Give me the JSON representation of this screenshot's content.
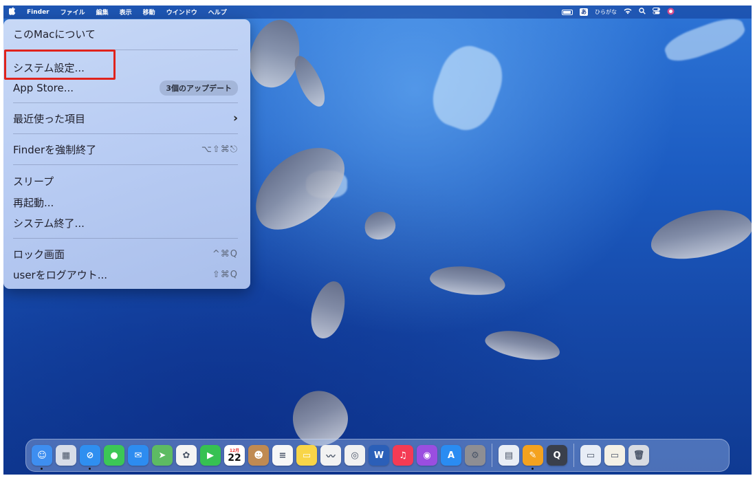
{
  "menubar": {
    "apple_icon": "",
    "items": [
      "Finder",
      "ファイル",
      "編集",
      "表示",
      "移動",
      "ウインドウ",
      "ヘルプ"
    ],
    "ime_box": "あ",
    "ime_label": "ひらがな",
    "status_icons": [
      "battery-icon",
      "wifi-icon",
      "search-icon",
      "control-center-icon",
      "siri-icon"
    ]
  },
  "apple_menu": {
    "about": "このMacについて",
    "system_settings": "システム設定...",
    "app_store": "App Store...",
    "app_store_badge": "3個のアップデート",
    "recent_items": "最近使った項目",
    "recent_chevron": "›",
    "force_quit": "Finderを強制終了",
    "force_quit_shortcut": "⌥⇧⌘⎋",
    "sleep": "スリープ",
    "restart": "再起動...",
    "shutdown": "システム終了...",
    "lock_screen": "ロック画面",
    "lock_shortcut": "^⌘Q",
    "logout": "userをログアウト...",
    "logout_shortcut": "⇧⌘Q"
  },
  "highlight_color": "#e0231c",
  "dock": {
    "calendar_month": "12月",
    "calendar_day": "22",
    "apps": [
      {
        "name": "finder-icon",
        "color": "#3e8ef0",
        "glyph": "☺",
        "running": true
      },
      {
        "name": "launchpad-icon",
        "color": "#d8dde8",
        "glyph": "▦",
        "running": false
      },
      {
        "name": "safari-icon",
        "color": "#2f8ff0",
        "glyph": "⊘",
        "running": true
      },
      {
        "name": "messages-icon",
        "color": "#3cc756",
        "glyph": "●",
        "running": false
      },
      {
        "name": "mail-icon",
        "color": "#2d8cf0",
        "glyph": "✉",
        "running": false
      },
      {
        "name": "maps-icon",
        "color": "#5dbb63",
        "glyph": "➤",
        "running": false
      },
      {
        "name": "photos-icon",
        "color": "#f4f4f4",
        "glyph": "✿",
        "running": false
      },
      {
        "name": "facetime-icon",
        "color": "#36c152",
        "glyph": "▶",
        "running": false
      },
      {
        "name": "calendar-icon",
        "color": "#ffffff",
        "glyph": "",
        "running": false
      },
      {
        "name": "contacts-icon",
        "color": "#c08a52",
        "glyph": "☻",
        "running": false
      },
      {
        "name": "reminders-icon",
        "color": "#f7f7f7",
        "glyph": "≡",
        "running": false
      },
      {
        "name": "notes-icon",
        "color": "#f8d548",
        "glyph": "▭",
        "running": false
      },
      {
        "name": "freeform-icon",
        "color": "#f2f2f2",
        "glyph": "〰",
        "running": false
      },
      {
        "name": "chrome-icon",
        "color": "#f1f1f1",
        "glyph": "◎",
        "running": false
      },
      {
        "name": "word-icon",
        "color": "#2b5fb8",
        "glyph": "W",
        "running": false
      },
      {
        "name": "music-icon",
        "color": "#f43b54",
        "glyph": "♫",
        "running": false
      },
      {
        "name": "podcasts-icon",
        "color": "#9a4ee0",
        "glyph": "◉",
        "running": false
      },
      {
        "name": "app-store-icon",
        "color": "#2a8cf2",
        "glyph": "A",
        "running": false
      },
      {
        "name": "system-settings-icon",
        "color": "#8e8e93",
        "glyph": "⚙",
        "running": false
      }
    ],
    "apps2": [
      {
        "name": "preview-icon",
        "color": "#e9eef5",
        "glyph": "▤",
        "running": false
      },
      {
        "name": "pages-icon",
        "color": "#f4a21f",
        "glyph": "✎",
        "running": true
      },
      {
        "name": "quicktime-icon",
        "color": "#3a3f4b",
        "glyph": "Q",
        "running": false
      }
    ],
    "stacks": [
      {
        "name": "downloads-stack-icon",
        "color": "#e7edf6",
        "glyph": "▭"
      },
      {
        "name": "documents-stack-icon",
        "color": "#f4f1e6",
        "glyph": "▭"
      },
      {
        "name": "trash-icon",
        "color": "#d7dbe2",
        "glyph": "🗑"
      }
    ]
  }
}
